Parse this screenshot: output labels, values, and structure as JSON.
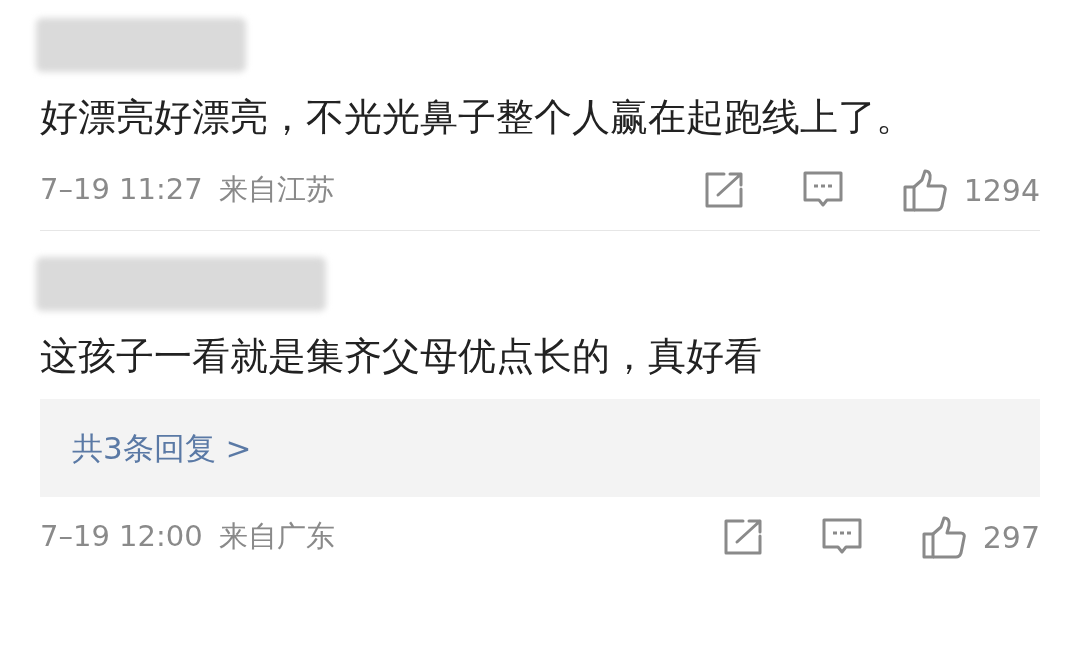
{
  "comments": [
    {
      "text": "好漂亮好漂亮，不光光鼻子整个人赢在起跑线上了。",
      "time": "7–19 11:27",
      "location": "来自江苏",
      "likes": "1294"
    },
    {
      "text": "这孩子一看就是集齐父母优点长的，真好看",
      "replies": "共3条回复 >",
      "time": "7–19 12:00",
      "location": "来自广东",
      "likes": "297"
    }
  ]
}
